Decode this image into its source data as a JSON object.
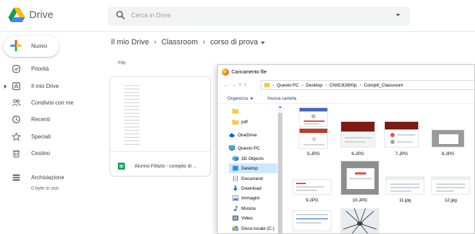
{
  "header": {
    "brand": "Drive",
    "search_placeholder": "Cerca in Drive"
  },
  "sidebar": {
    "new_label": "Nuovo",
    "items": [
      {
        "label": "Priorità",
        "icon": "check-circle-icon"
      },
      {
        "label": "Il mio Drive",
        "icon": "drive-icon"
      },
      {
        "label": "Condivisi con me",
        "icon": "people-icon"
      },
      {
        "label": "Recenti",
        "icon": "clock-icon"
      },
      {
        "label": "Speciali",
        "icon": "star-icon"
      },
      {
        "label": "Cestino",
        "icon": "trash-icon"
      }
    ],
    "storage": {
      "label": "Archiviazione",
      "usage": "0 byte in uso"
    }
  },
  "breadcrumb": [
    "Il mio Drive",
    "Classroom",
    "corso di prova"
  ],
  "main": {
    "section_label": "File",
    "file": {
      "name": "Alunno Fittizio - compito di ..."
    }
  },
  "dialog": {
    "title": "Caricamento file",
    "path": [
      "Questo PC",
      "Desktop",
      "CNIIC82800p",
      "Compiti_Classroom"
    ],
    "organize_label": "Organizza",
    "new_folder_label": "Nuova cartella",
    "nav_items": [
      {
        "label": "",
        "icon": "folder-icon"
      },
      {
        "label": "pdf",
        "icon": "folder-icon"
      },
      {
        "label": "OneDrive",
        "icon": "cloud-icon"
      },
      {
        "label": "Questo PC",
        "icon": "pc-icon"
      },
      {
        "label": "3D Objects",
        "icon": "cube-icon"
      },
      {
        "label": "Desktop",
        "icon": "desktop-icon"
      },
      {
        "label": "Documenti",
        "icon": "document-icon"
      },
      {
        "label": "Download",
        "icon": "download-icon"
      },
      {
        "label": "Immagini",
        "icon": "image-icon"
      },
      {
        "label": "Musica",
        "icon": "music-icon"
      },
      {
        "label": "Video",
        "icon": "video-icon"
      },
      {
        "label": "Disco locale (C:)",
        "icon": "disk-icon"
      }
    ],
    "selected_nav": "Desktop",
    "files": [
      {
        "name": "5.JPG"
      },
      {
        "name": "6.JPG"
      },
      {
        "name": "7.JPG"
      },
      {
        "name": "8.JPG"
      },
      {
        "name": "9.JPG"
      },
      {
        "name": "10.JPG"
      },
      {
        "name": "11.jpg"
      },
      {
        "name": "12.jpg"
      }
    ]
  },
  "colors": {
    "accent": "#1a73e8",
    "nav_selected": "#cce8ff",
    "sheets_green": "#0f9d58"
  }
}
